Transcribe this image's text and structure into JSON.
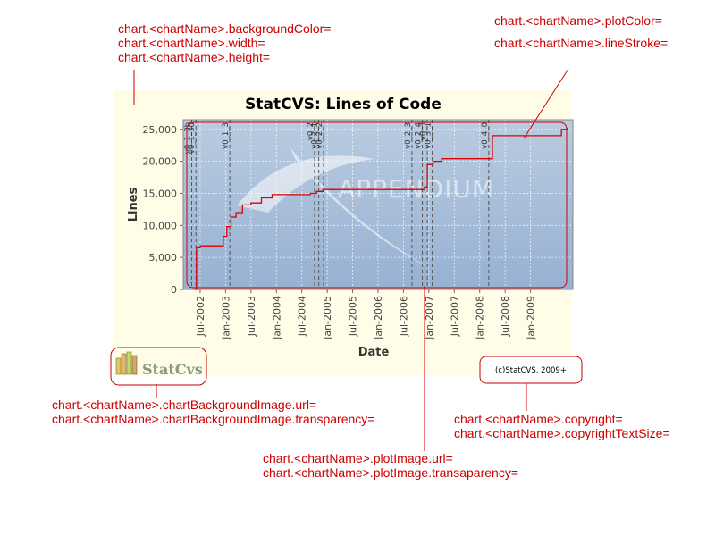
{
  "annotations": {
    "background": [
      "chart.<chartName>.backgroundColor=",
      "chart.<chartName>.width=",
      "chart.<chartName>.height="
    ],
    "plot_color": [
      "chart.<chartName>.plotColor=",
      "chart.<chartName>.lineStroke="
    ],
    "chart_bg_image": [
      "chart.<chartName>.chartBackgroundImage.url=",
      "chart.<chartName>.chartBackgroundImage.transparency="
    ],
    "plot_image": [
      "chart.<chartName>.plotImage.url=",
      "chart.<chartName>.plotImage.transaparency="
    ],
    "copyright": [
      "chart.<chartName>.copyright=",
      "chart.<chartName>.copyrightTextSize="
    ]
  },
  "copyright_text": "(c)StatCVS, 2009+",
  "logo_text": "StatCvs",
  "watermark_text": "APPENDIUM",
  "colors": {
    "annotation": "#cc0000",
    "chart_bg": "#fffce8",
    "plot_bg": "#a9c0dc",
    "line": "#dd0000"
  },
  "chart_data": {
    "type": "line",
    "title": "StatCVS: Lines of Code",
    "xlabel": "Date",
    "ylabel": "Lines",
    "ylim": [
      0,
      26500
    ],
    "yticks": [
      0,
      5000,
      10000,
      15000,
      20000,
      25000
    ],
    "ytick_labels": [
      "0",
      "5,000",
      "10,000",
      "15,000",
      "20,000",
      "25,000"
    ],
    "xlim": [
      "2002-03",
      "2009-11"
    ],
    "xticks": [
      "2002-07",
      "2003-01",
      "2003-07",
      "2004-01",
      "2004-07",
      "2005-01",
      "2005-07",
      "2006-01",
      "2006-07",
      "2007-01",
      "2007-07",
      "2008-01",
      "2008-07",
      "2009-01"
    ],
    "xtick_labels": [
      "Jul-2002",
      "Jan-2003",
      "Jul-2003",
      "Jan-2004",
      "Jul-2004",
      "Jan-2005",
      "Jul-2005",
      "Jan-2006",
      "Jul-2006",
      "Jan-2007",
      "Jul-2007",
      "Jan-2008",
      "Jul-2008",
      "Jan-2009"
    ],
    "grid": true,
    "series": [
      {
        "type": "step",
        "points": [
          [
            "2002-05-20",
            0
          ],
          [
            "2002-06-05",
            6500
          ],
          [
            "2002-07-01",
            6800
          ],
          [
            "2002-12-01",
            6800
          ],
          [
            "2002-12-15",
            8300
          ],
          [
            "2003-01-10",
            9800
          ],
          [
            "2003-02-10",
            11300
          ],
          [
            "2003-03-15",
            12000
          ],
          [
            "2003-05-01",
            13200
          ],
          [
            "2003-07-01",
            13500
          ],
          [
            "2003-09-15",
            14300
          ],
          [
            "2003-12-01",
            14800
          ],
          [
            "2004-09-01",
            15000
          ],
          [
            "2004-10-15",
            15300
          ],
          [
            "2004-12-01",
            15600
          ],
          [
            "2005-06-01",
            15600
          ],
          [
            "2006-11-15",
            15600
          ],
          [
            "2006-12-01",
            16000
          ],
          [
            "2006-12-20",
            19500
          ],
          [
            "2007-02-01",
            20000
          ],
          [
            "2007-04-01",
            20400
          ],
          [
            "2008-03-01",
            20400
          ],
          [
            "2008-04-01",
            24000
          ],
          [
            "2009-06-01",
            24000
          ],
          [
            "2009-08-10",
            25000
          ],
          [
            "2009-09-20",
            25200
          ]
        ]
      }
    ],
    "markers": [
      {
        "date": "2002-05-01",
        "label": "v0_1_3b"
      },
      {
        "date": "2002-06-01",
        "label": "v0_1_3d"
      },
      {
        "date": "2003-02-01",
        "label": "v0_1_3"
      },
      {
        "date": "2004-10-01",
        "label": "v0_2"
      },
      {
        "date": "2004-11-01",
        "label": "v0_2_1"
      },
      {
        "date": "2004-12-05",
        "label": "v0_2_2"
      },
      {
        "date": "2006-09-01",
        "label": "v0_2_3"
      },
      {
        "date": "2006-11-15",
        "label": "v0_2_4"
      },
      {
        "date": "2006-12-20",
        "label": "v0_3"
      },
      {
        "date": "2007-01-25",
        "label": "v0_3_1"
      },
      {
        "date": "2008-03-05",
        "label": "v0_4_0"
      }
    ]
  }
}
